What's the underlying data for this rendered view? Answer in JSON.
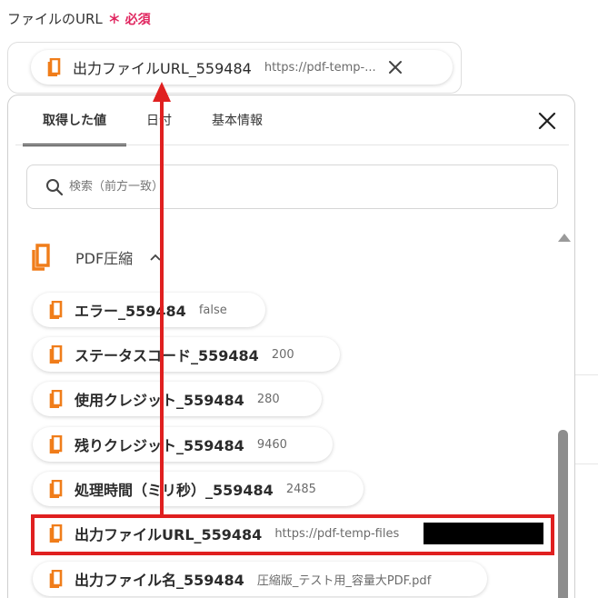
{
  "field": {
    "label": "ファイルのURL",
    "required_mark": "＊",
    "required_text": "必須",
    "selected_chip": {
      "name": "出力ファイルURL_559484",
      "value": "https://pdf-temp-..."
    }
  },
  "popover": {
    "tabs": [
      {
        "label": "取得した値",
        "active": true
      },
      {
        "label": "日付",
        "active": false
      },
      {
        "label": "基本情報",
        "active": false
      }
    ],
    "search": {
      "placeholder": "検索（前方一致）"
    },
    "group": {
      "title": "PDF圧縮",
      "items": [
        {
          "name": "エラー_559484",
          "value": "false"
        },
        {
          "name": "ステータスコード_559484",
          "value": "200"
        },
        {
          "name": "使用クレジット_559484",
          "value": "280"
        },
        {
          "name": "残りクレジット_559484",
          "value": "9460"
        },
        {
          "name": "処理時間（ミリ秒）_559484",
          "value": "2485"
        },
        {
          "name": "出力ファイルURL_559484",
          "value": "https://pdf-temp-files"
        },
        {
          "name": "出力ファイル名_559484",
          "value": "圧縮版_テスト用_容量大PDF.pdf"
        }
      ]
    }
  },
  "colors": {
    "icon_orange": "#f07d1a",
    "required_red": "#e0245e",
    "highlight_red": "#e02020",
    "text": "#333333"
  },
  "icons": [
    "document-icon",
    "close-icon",
    "search-icon",
    "chevron-up-icon",
    "scroll-up-icon"
  ]
}
